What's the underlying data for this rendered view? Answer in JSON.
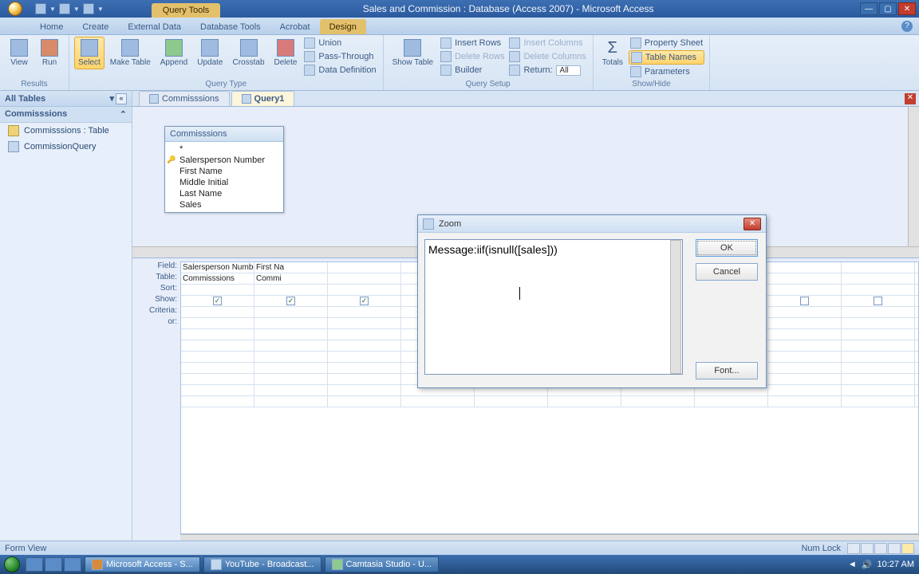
{
  "window": {
    "context_tab": "Query Tools",
    "title": "Sales and Commission : Database (Access 2007) - Microsoft Access"
  },
  "ribbon_tabs": [
    "Home",
    "Create",
    "External Data",
    "Database Tools",
    "Acrobat",
    "Design"
  ],
  "ribbon": {
    "results": {
      "view": "View",
      "run": "Run",
      "label": "Results"
    },
    "query_type": {
      "select": "Select",
      "make_table": "Make\nTable",
      "append": "Append",
      "update": "Update",
      "crosstab": "Crosstab",
      "delete": "Delete",
      "union": "Union",
      "pass_through": "Pass-Through",
      "data_def": "Data Definition",
      "label": "Query Type"
    },
    "query_setup": {
      "show_table": "Show\nTable",
      "insert_rows": "Insert Rows",
      "delete_rows": "Delete Rows",
      "builder": "Builder",
      "insert_cols": "Insert Columns",
      "delete_cols": "Delete Columns",
      "return": "Return:",
      "return_value": "All",
      "label": "Query Setup"
    },
    "show_hide": {
      "totals": "Totals",
      "prop_sheet": "Property Sheet",
      "table_names": "Table Names",
      "parameters": "Parameters",
      "label": "Show/Hide"
    }
  },
  "nav": {
    "header": "All Tables",
    "group": "Commisssions",
    "items": [
      {
        "label": "Commisssions : Table",
        "icon": "table"
      },
      {
        "label": "CommissionQuery",
        "icon": "query"
      }
    ]
  },
  "doc_tabs": [
    {
      "label": "Commisssions",
      "active": false
    },
    {
      "label": "Query1",
      "active": true
    }
  ],
  "table_box": {
    "title": "Commisssions",
    "star": "*",
    "fields": [
      "Salersperson Number",
      "First Name",
      "Middle Initial",
      "Last Name",
      "Sales"
    ]
  },
  "grid": {
    "row_labels": [
      "Field:",
      "Table:",
      "Sort:",
      "Show:",
      "Criteria:",
      "or:"
    ],
    "columns": [
      {
        "field": "Salersperson Number",
        "table": "Commisssions",
        "show": true
      },
      {
        "field": "First Na",
        "table": "Commi",
        "show": true
      },
      {
        "field": "",
        "table": "",
        "show": true
      },
      {
        "field": "",
        "table": "",
        "show": true
      },
      {
        "field": "",
        "table": "",
        "show": true
      },
      {
        "field": "",
        "table": "",
        "show": false
      },
      {
        "field": "",
        "table": "",
        "show": false
      },
      {
        "field": "",
        "table": "",
        "show": false
      },
      {
        "field": "",
        "table": "",
        "show": false
      },
      {
        "field": "",
        "table": "",
        "show": false
      }
    ]
  },
  "zoom": {
    "title": "Zoom",
    "text": "Message:iif(isnull([sales]))",
    "ok": "OK",
    "cancel": "Cancel",
    "font": "Font..."
  },
  "status": {
    "left": "Form View",
    "numlock": "Num Lock"
  },
  "taskbar": {
    "tasks": [
      "Microsoft Access - S...",
      "YouTube - Broadcast...",
      "Camtasia Studio - U..."
    ],
    "time": "10:27 AM"
  }
}
